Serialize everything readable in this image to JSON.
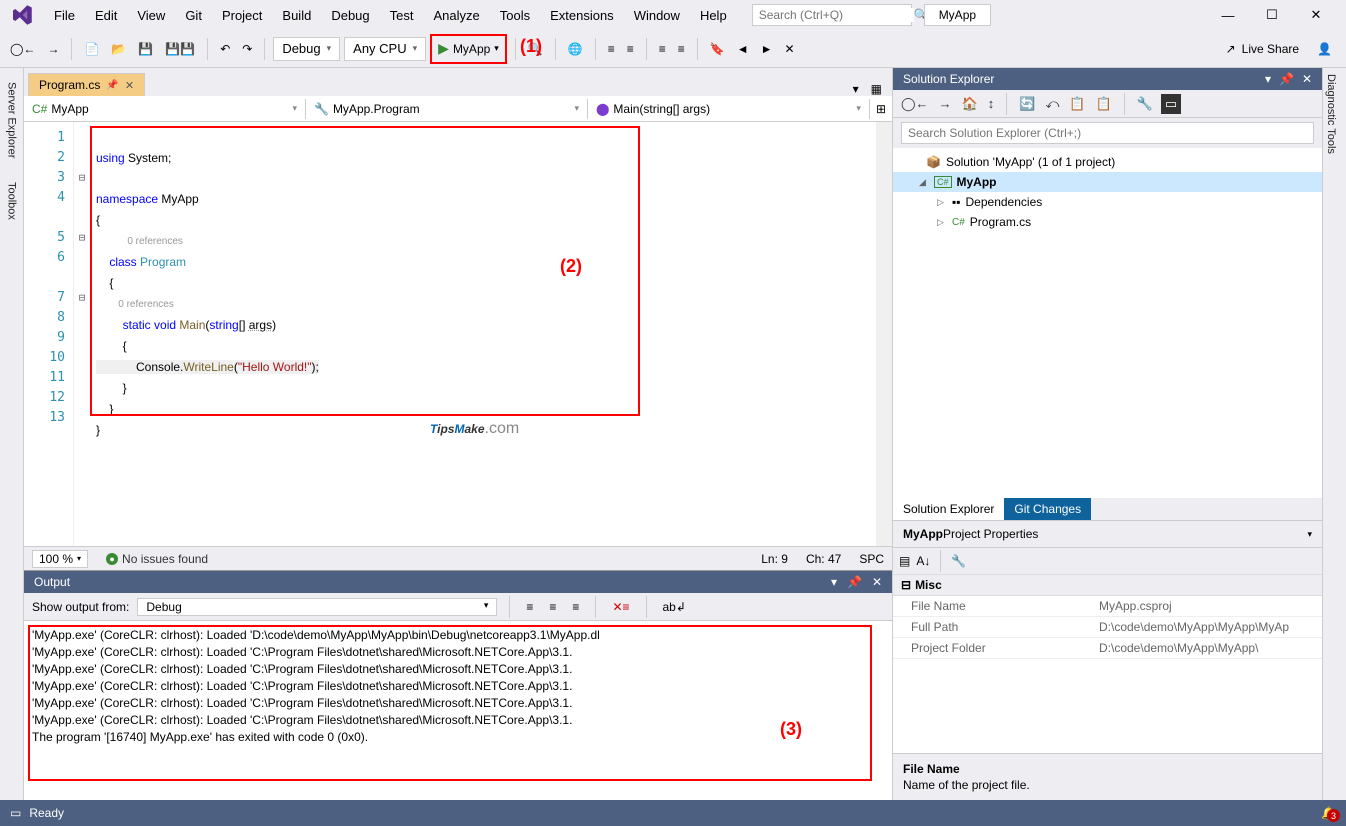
{
  "menu": {
    "items": [
      "File",
      "Edit",
      "View",
      "Git",
      "Project",
      "Build",
      "Debug",
      "Test",
      "Analyze",
      "Tools",
      "Extensions",
      "Window",
      "Help"
    ]
  },
  "search": {
    "placeholder": "Search (Ctrl+Q)"
  },
  "title_app": "MyApp",
  "toolbar": {
    "config": "Debug",
    "platform": "Any CPU",
    "run": "MyApp",
    "liveshare": "Live Share"
  },
  "callouts": {
    "c1": "(1)",
    "c2": "(2)",
    "c3": "(3)"
  },
  "lefttabs": {
    "se": "Server Explorer",
    "tb": "Toolbox"
  },
  "righttabs": {
    "dt": "Diagnostic Tools"
  },
  "tabs": {
    "t1": "Program.cs"
  },
  "nav": {
    "n1": "MyApp",
    "n2": "MyApp.Program",
    "n3": "Main(string[] args)"
  },
  "code": {
    "l1a": "using ",
    "l1b": "System;",
    "l3a": "namespace ",
    "l3b": "MyApp",
    "l4": "{",
    "lref1": "0 references",
    "l5a": "    class ",
    "l5b": "Program",
    "l6": "    {",
    "lref2": "        0 references",
    "l7a": "        static ",
    "l7b": "void ",
    "l7c": "Main",
    "l7d": "(",
    "l7e": "string",
    "l7f": "[] ",
    "l7g": "args",
    "l7h": ")",
    "l8": "        {",
    "l9a": "            Console.",
    "l9b": "WriteLine",
    "l9c": "(",
    "l9d": "\"Hello World!\"",
    "l9e": ");",
    "l10": "        }",
    "l11": "    }",
    "l12": "}"
  },
  "editor_status": {
    "zoom": "100 %",
    "issues": "No issues found",
    "ln": "Ln: 9",
    "ch": "Ch: 47",
    "spc": "SPC"
  },
  "output": {
    "title": "Output",
    "from_label": "Show output from:",
    "from": "Debug",
    "lines": [
      "'MyApp.exe' (CoreCLR: clrhost): Loaded 'D:\\code\\demo\\MyApp\\MyApp\\bin\\Debug\\netcoreapp3.1\\MyApp.dl",
      "'MyApp.exe' (CoreCLR: clrhost): Loaded 'C:\\Program Files\\dotnet\\shared\\Microsoft.NETCore.App\\3.1.",
      "'MyApp.exe' (CoreCLR: clrhost): Loaded 'C:\\Program Files\\dotnet\\shared\\Microsoft.NETCore.App\\3.1.",
      "'MyApp.exe' (CoreCLR: clrhost): Loaded 'C:\\Program Files\\dotnet\\shared\\Microsoft.NETCore.App\\3.1.",
      "'MyApp.exe' (CoreCLR: clrhost): Loaded 'C:\\Program Files\\dotnet\\shared\\Microsoft.NETCore.App\\3.1.",
      "'MyApp.exe' (CoreCLR: clrhost): Loaded 'C:\\Program Files\\dotnet\\shared\\Microsoft.NETCore.App\\3.1.",
      "The program '[16740] MyApp.exe' has exited with code 0 (0x0)."
    ]
  },
  "solution_explorer": {
    "title": "Solution Explorer",
    "search": "Search Solution Explorer (Ctrl+;)",
    "sln": "Solution 'MyApp' (1 of 1 project)",
    "proj": "MyApp",
    "dep": "Dependencies",
    "file": "Program.cs",
    "tab1": "Solution Explorer",
    "tab2": "Git Changes"
  },
  "props": {
    "header_bold": "MyApp",
    "header_rest": " Project Properties",
    "cat": "Misc",
    "rows": [
      {
        "name": "File Name",
        "val": "MyApp.csproj"
      },
      {
        "name": "Full Path",
        "val": "D:\\code\\demo\\MyApp\\MyApp\\MyAp"
      },
      {
        "name": "Project Folder",
        "val": "D:\\code\\demo\\MyApp\\MyApp\\"
      }
    ],
    "desc_title": "File Name",
    "desc_text": "Name of the project file."
  },
  "status": {
    "ready": "Ready",
    "notif": "3"
  }
}
